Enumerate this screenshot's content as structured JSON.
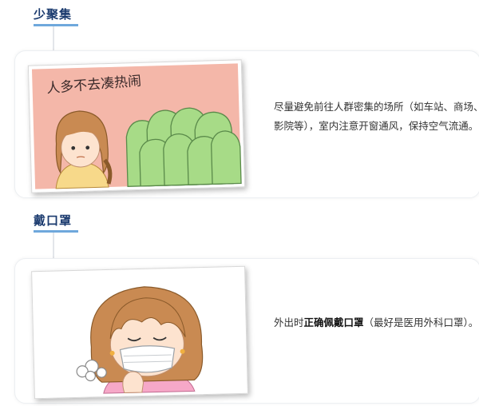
{
  "section1": {
    "heading": "少聚集",
    "image_caption": "人多不去凑热闹",
    "text": "尽量避免前往人群密集的场所（如车站、商场、影院等），室内注意开窗通风，保持空气流通。"
  },
  "section2": {
    "heading": "戴口罩",
    "text_before": "外出时",
    "text_bold": "正确佩戴口罩",
    "text_after": "（最好是医用外科口罩）。"
  }
}
